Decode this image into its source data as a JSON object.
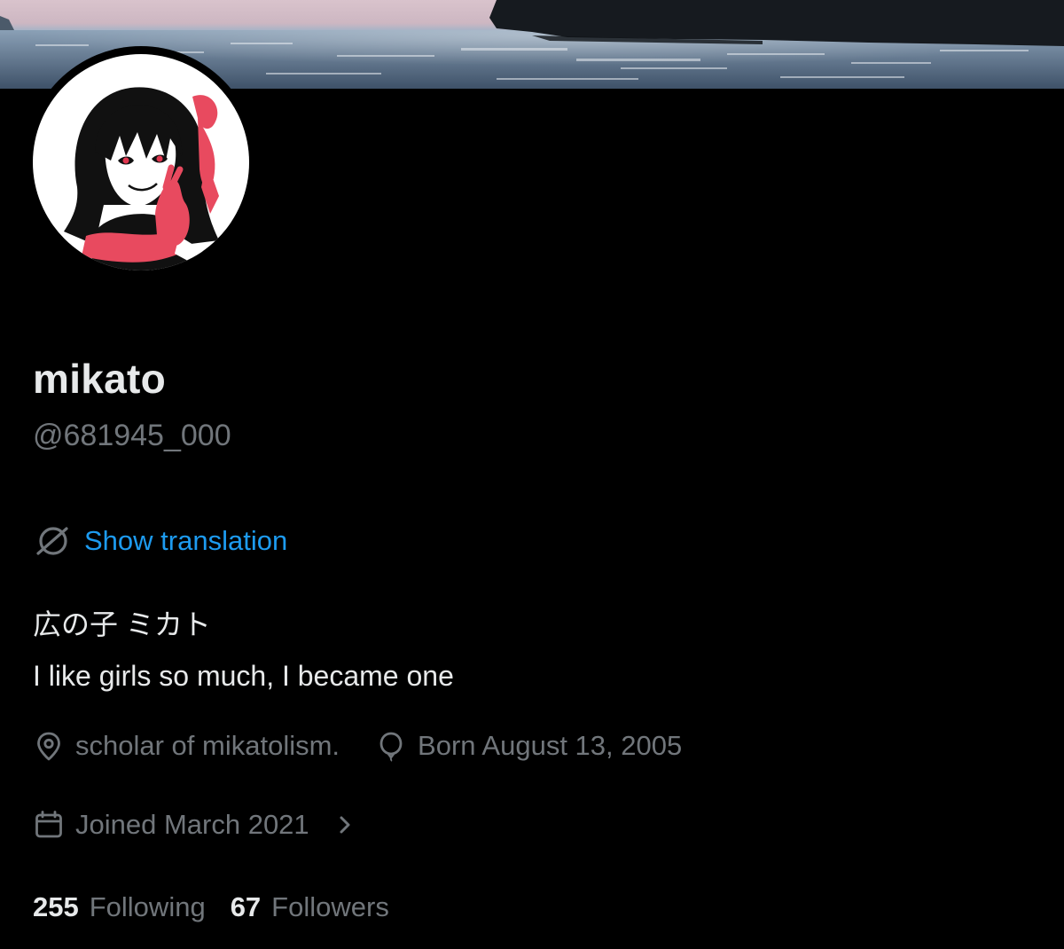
{
  "profile": {
    "display_name": "mikato",
    "handle": "@681945_000"
  },
  "translation": {
    "label": "Show translation",
    "icon": "globe-strike-icon",
    "link_color": "#1d9bf0"
  },
  "bio": {
    "line1": "広の子 ミカト",
    "line2": "I like girls so much, I became one"
  },
  "meta": {
    "location": {
      "icon": "location-pin-icon",
      "text": "scholar of mikatolism."
    },
    "birthday": {
      "icon": "balloon-icon",
      "text": "Born August 13, 2005"
    },
    "joined": {
      "icon": "calendar-icon",
      "text": "Joined March 2021"
    }
  },
  "stats": {
    "following_count": "255",
    "following_label": "Following",
    "followers_count": "67",
    "followers_label": "Followers"
  },
  "colors": {
    "background": "#000000",
    "primary_text": "#e7e9ea",
    "secondary_text": "#71767b",
    "accent": "#1d9bf0"
  }
}
